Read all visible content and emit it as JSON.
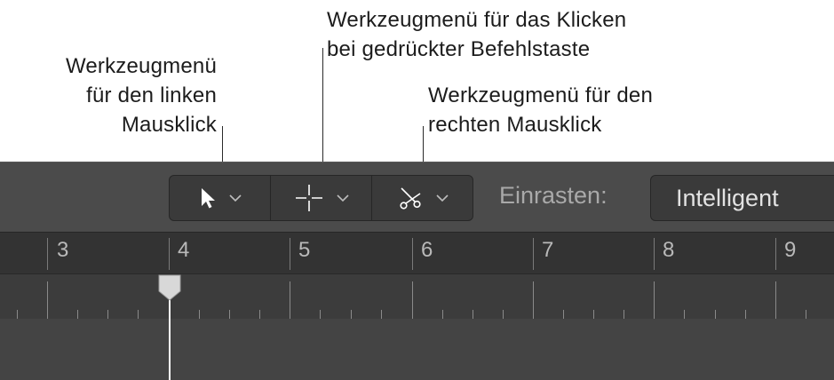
{
  "callouts": {
    "left_click": [
      "Werkzeugmenü",
      "für den linken",
      "Mausklick"
    ],
    "command_click": [
      "Werkzeugmenü für das Klicken",
      "bei gedrückter Befehlstaste"
    ],
    "right_click": [
      "Werkzeugmenü für den",
      "rechten Mausklick"
    ]
  },
  "toolbar": {
    "tools": [
      {
        "icon": "pointer-icon"
      },
      {
        "icon": "crosshair-icon"
      },
      {
        "icon": "scissors-icon"
      }
    ],
    "snap_label": "Einrasten:",
    "snap_value": "Intelligent"
  },
  "ruler": {
    "bars": [
      "3",
      "4",
      "5",
      "6",
      "7",
      "8",
      "9"
    ]
  },
  "colors": {
    "toolbar_bg": "#4b4b4b",
    "ruler_bg": "#333333",
    "playhead": "#ffffff"
  }
}
